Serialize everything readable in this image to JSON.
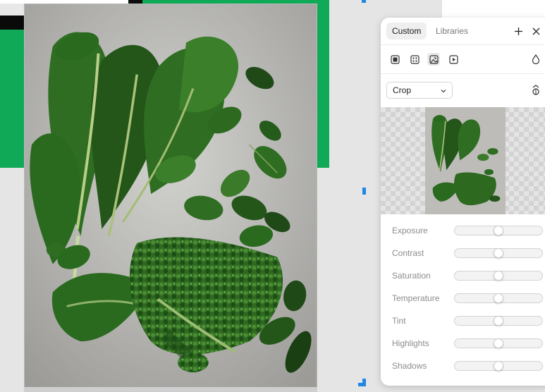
{
  "panel": {
    "tabs": [
      {
        "label": "Custom",
        "active": true
      },
      {
        "label": "Libraries",
        "active": false
      }
    ],
    "add_icon": "plus-icon",
    "close_icon": "close-icon",
    "fill_types": [
      {
        "icon": "solid-fill-icon",
        "active": false
      },
      {
        "icon": "pattern-fill-icon",
        "active": false
      },
      {
        "icon": "image-fill-icon",
        "active": true
      },
      {
        "icon": "video-fill-icon",
        "active": false
      }
    ],
    "drop_icon": "drop-icon",
    "scale_mode": {
      "value": "Crop",
      "icon": "chevron-down-icon"
    },
    "rotate_icon": "rotate-icon",
    "adjustments": [
      {
        "label": "Exposure",
        "value": 0.5
      },
      {
        "label": "Contrast",
        "value": 0.5
      },
      {
        "label": "Saturation",
        "value": 0.5
      },
      {
        "label": "Temperature",
        "value": 0.5
      },
      {
        "label": "Tint",
        "value": 0.5
      },
      {
        "label": "Highlights",
        "value": 0.5
      },
      {
        "label": "Shadows",
        "value": 0.5
      }
    ]
  },
  "colors": {
    "canvas_green": "#0fa957",
    "selection_blue": "#1e88e5",
    "photo_background": "#c2c1bd",
    "leaf_dark": "#1f4a17",
    "leaf_mid": "#2f6e22",
    "leaf_light": "#4a8c33"
  }
}
